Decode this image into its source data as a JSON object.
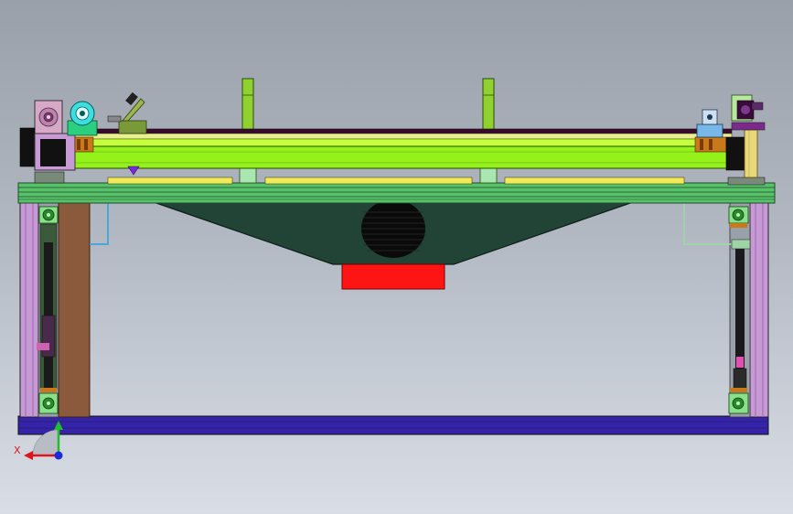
{
  "viewport": {
    "background_top": "#9aa0aa",
    "background_bottom": "#d9dee6"
  },
  "triad": {
    "x_axis_label": "X",
    "x_color": "#e0141c",
    "y_color": "#1fbf2a",
    "z_color": "#1e2ad8"
  },
  "colors": {
    "rail_green": "#94f21a",
    "rail_bright": "#c6ff3c",
    "post_green": "#8fd22f",
    "hopper": "#214436",
    "hopper_edge": "#0d1f18",
    "red_block": "#ff1414",
    "base_blue": "#3524a8",
    "frame_pink": "#c79ad6",
    "wood_brown": "#8b5a3c",
    "table_green": "#57c26a",
    "motor_gold": "#e8d87a"
  }
}
